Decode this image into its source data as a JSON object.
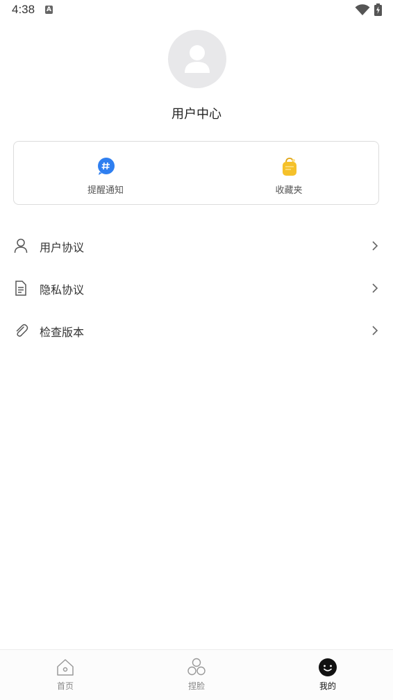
{
  "status_bar": {
    "time": "4:38",
    "notification_icon": "a-icon",
    "wifi_icon": "wifi-icon",
    "battery_icon": "battery-charging-icon"
  },
  "profile": {
    "avatar_icon": "user-avatar-icon",
    "title": "用户中心"
  },
  "shortcuts": [
    {
      "label": "提醒通知",
      "icon": "hashtag-notice-icon",
      "color": "#2f7ff0"
    },
    {
      "label": "收藏夹",
      "icon": "shopping-bag-icon",
      "color": "#f5c12a"
    }
  ],
  "menu": [
    {
      "label": "用户协议",
      "icon": "person-icon"
    },
    {
      "label": "隐私协议",
      "icon": "document-icon"
    },
    {
      "label": "检查版本",
      "icon": "paperclip-icon"
    }
  ],
  "tabs": [
    {
      "label": "首页",
      "icon": "home-icon",
      "active": false
    },
    {
      "label": "捏脸",
      "icon": "circles-icon",
      "active": false
    },
    {
      "label": "我的",
      "icon": "smiley-face-icon",
      "active": true
    }
  ]
}
